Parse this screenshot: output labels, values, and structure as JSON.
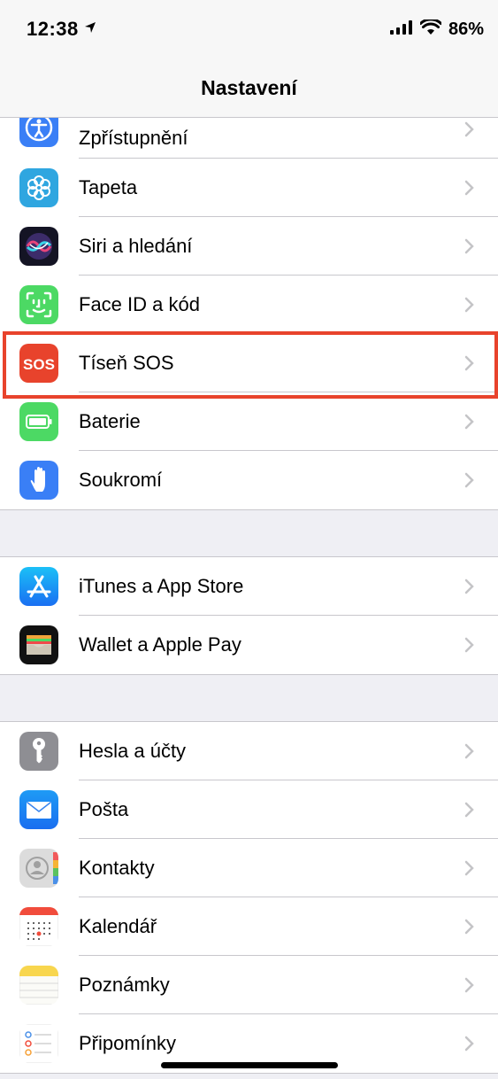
{
  "status_bar": {
    "time": "12:38",
    "battery": "86%"
  },
  "nav": {
    "title": "Nastavení"
  },
  "groups": [
    {
      "items": [
        {
          "label": "Zpřístupnění",
          "icon": "accessibility-icon"
        },
        {
          "label": "Tapeta",
          "icon": "wallpaper-icon"
        },
        {
          "label": "Siri a hledání",
          "icon": "siri-icon"
        },
        {
          "label": "Face ID a kód",
          "icon": "face-id-icon"
        },
        {
          "label": "Tíseň SOS",
          "icon": "sos-icon",
          "icon_text": "SOS"
        },
        {
          "label": "Baterie",
          "icon": "battery-icon"
        },
        {
          "label": "Soukromí",
          "icon": "privacy-hand-icon",
          "highlighted": true
        }
      ]
    },
    {
      "items": [
        {
          "label": "iTunes a App Store",
          "icon": "app-store-icon"
        },
        {
          "label": "Wallet a Apple Pay",
          "icon": "wallet-icon"
        }
      ]
    },
    {
      "items": [
        {
          "label": "Hesla a účty",
          "icon": "key-icon"
        },
        {
          "label": "Pošta",
          "icon": "mail-icon"
        },
        {
          "label": "Kontakty",
          "icon": "contacts-icon"
        },
        {
          "label": "Kalendář",
          "icon": "calendar-icon"
        },
        {
          "label": "Poznámky",
          "icon": "notes-icon"
        },
        {
          "label": "Připomínky",
          "icon": "reminders-icon"
        }
      ]
    }
  ],
  "colors": {
    "highlight": "#e8432c",
    "accessibility": "#3a7ff6",
    "wallpaper": "#2fa6e0",
    "face_id": "#4cd964",
    "sos": "#e8432c",
    "battery": "#4cd964",
    "privacy": "#3a7ff6",
    "app_store": "#1a8cf2"
  }
}
